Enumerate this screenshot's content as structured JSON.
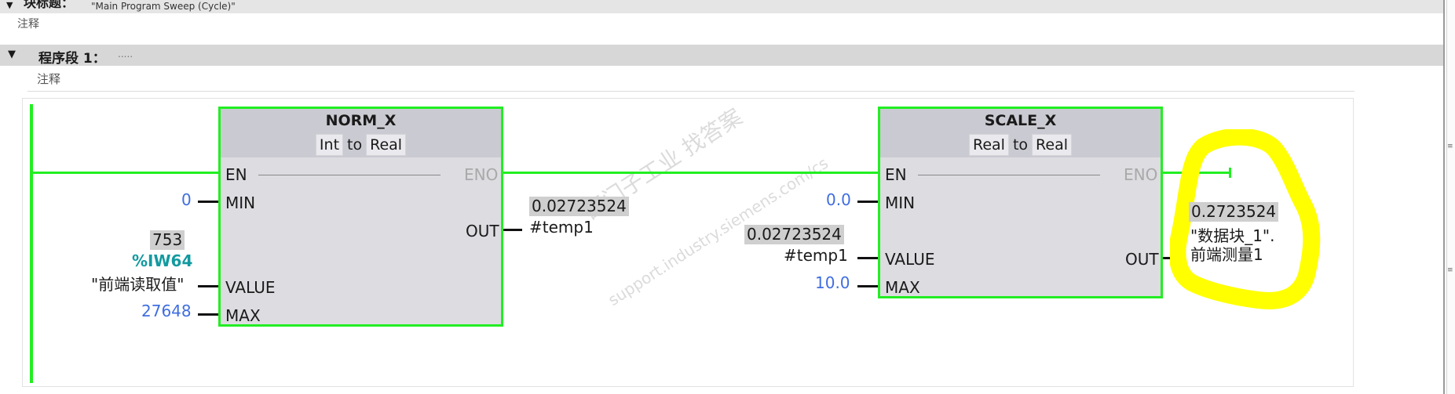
{
  "block": {
    "title_label": "块标题：",
    "title_value": "\"Main Program Sweep (Cycle)\"",
    "comment": "注释"
  },
  "network": {
    "label": "程序段 1：",
    "title_placeholder": ".....",
    "comment": "注释"
  },
  "watermark": {
    "line1": "西门子工业  找答案",
    "line2": "support.industry.siemens.com/cs"
  },
  "norm_x": {
    "name": "NORM_X",
    "in_type": "Int",
    "to": "to",
    "out_type": "Real",
    "pins": {
      "en": "EN",
      "eno": "ENO",
      "min": "MIN",
      "value": "VALUE",
      "max": "MAX",
      "out": "OUT"
    },
    "min_operand": "0",
    "value_live": "753",
    "value_address": "%IW64",
    "value_tag": "\"前端读取值\"",
    "max_operand": "27648",
    "out_live": "0.02723524",
    "out_tag": "#temp1"
  },
  "scale_x": {
    "name": "SCALE_X",
    "in_type": "Real",
    "to": "to",
    "out_type": "Real",
    "pins": {
      "en": "EN",
      "eno": "ENO",
      "min": "MIN",
      "value": "VALUE",
      "max": "MAX",
      "out": "OUT"
    },
    "min_operand": "0.0",
    "value_live": "0.02723524",
    "value_tag": "#temp1",
    "max_operand": "10.0",
    "out_live": "0.2723524",
    "out_tag_line1": "\"数据块_1\".",
    "out_tag_line2": "前端测量1"
  },
  "colors": {
    "powerflow_green": "#22ee22",
    "constant_blue": "#3f6ee0",
    "address_teal": "#139aa0",
    "highlight_yellow": "#ffff00"
  },
  "icons": [
    "collapse-caret-icon"
  ]
}
